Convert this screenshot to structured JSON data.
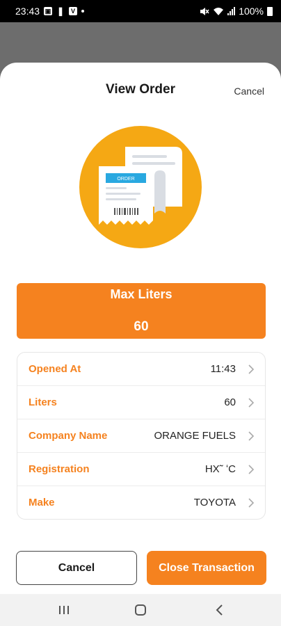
{
  "status_bar": {
    "time": "23:43",
    "battery": "100%",
    "left_icons": [
      "gallery-icon",
      "vibrate-icon",
      "v-app-icon",
      "dot-icon"
    ],
    "right_icons": [
      "mute-icon",
      "wifi-icon",
      "signal-icon",
      "battery-icon"
    ]
  },
  "sheet": {
    "title": "View Order",
    "cancel_link": "Cancel"
  },
  "illustration": {
    "receipt_tag": "ORDER",
    "colors": {
      "circle": "#f5a814",
      "tag": "#29a8e0",
      "paper": "#ffffff",
      "shadow": "#d9dde3"
    }
  },
  "max_card": {
    "label": "Max Liters",
    "value": "60",
    "color": "#f5821f"
  },
  "details": [
    {
      "label": "Opened At",
      "value": "11:43"
    },
    {
      "label": "Liters",
      "value": "60"
    },
    {
      "label": "Company Name",
      "value": "ORANGE FUELS"
    },
    {
      "label": "Registration",
      "value": "HX˜    ʻC"
    },
    {
      "label": "Make",
      "value": "TOYOTA"
    }
  ],
  "buttons": {
    "cancel": "Cancel",
    "close": "Close Transaction"
  },
  "nav_bar": {
    "icons": [
      "recents-icon",
      "home-icon",
      "back-icon"
    ]
  }
}
